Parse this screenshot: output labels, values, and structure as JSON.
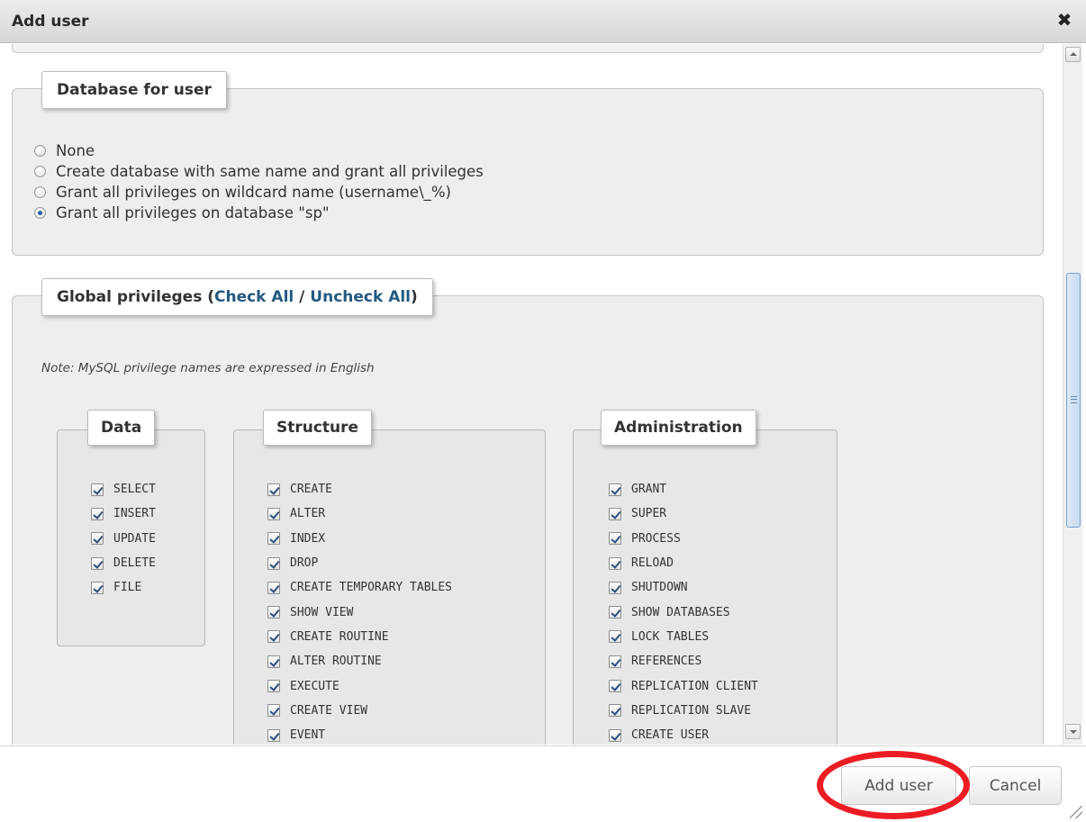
{
  "dialog": {
    "title": "Add user",
    "close_symbol": "✖"
  },
  "database_section": {
    "legend": "Database for user",
    "options": [
      {
        "label": "None",
        "checked": false
      },
      {
        "label": "Create database with same name and grant all privileges",
        "checked": false
      },
      {
        "label": "Grant all privileges on wildcard name (username\\_%)",
        "checked": false
      },
      {
        "label": "Grant all privileges on database \"sp\"",
        "checked": true
      }
    ]
  },
  "global_privileges": {
    "legend_prefix": "Global privileges (",
    "check_all": "Check All",
    "separator": " / ",
    "uncheck_all": "Uncheck All",
    "legend_suffix": ")",
    "note": "Note: MySQL privilege names are expressed in English",
    "data": {
      "legend": "Data",
      "items": [
        "SELECT",
        "INSERT",
        "UPDATE",
        "DELETE",
        "FILE"
      ]
    },
    "structure": {
      "legend": "Structure",
      "items": [
        "CREATE",
        "ALTER",
        "INDEX",
        "DROP",
        "CREATE TEMPORARY TABLES",
        "SHOW VIEW",
        "CREATE ROUTINE",
        "ALTER ROUTINE",
        "EXECUTE",
        "CREATE VIEW",
        "EVENT"
      ]
    },
    "administration": {
      "legend": "Administration",
      "items": [
        "GRANT",
        "SUPER",
        "PROCESS",
        "RELOAD",
        "SHUTDOWN",
        "SHOW DATABASES",
        "LOCK TABLES",
        "REFERENCES",
        "REPLICATION CLIENT",
        "REPLICATION SLAVE",
        "CREATE USER"
      ]
    }
  },
  "footer": {
    "add_user_label": "Add user",
    "cancel_label": "Cancel"
  },
  "colors": {
    "highlight": "#ec1c24",
    "link": "#235a81",
    "checkmark": "#2f4f7a"
  }
}
